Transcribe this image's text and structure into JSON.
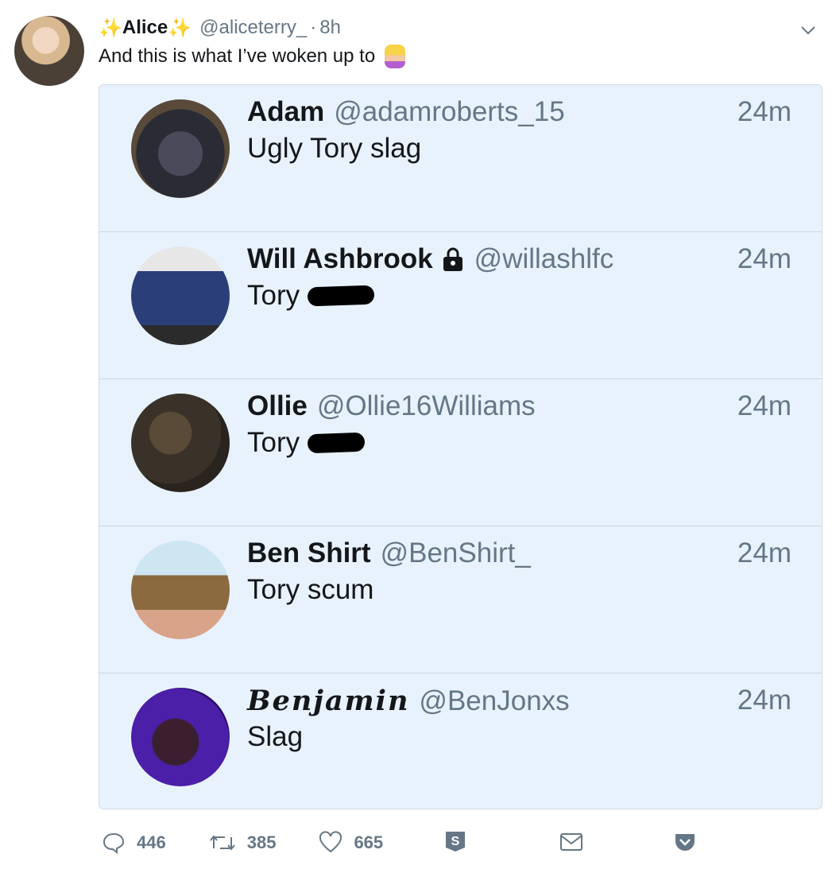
{
  "tweet": {
    "name": "Alice",
    "handle": "@aliceterry_",
    "separator": "·",
    "time": "8h",
    "text": "And this is what I’ve woken up to",
    "sparkle": "✨"
  },
  "replies": [
    {
      "name": "Adam",
      "handle": "@adamroberts_15",
      "time": "24m",
      "text": "Ugly Tory slag"
    },
    {
      "name": "Will Ashbrook",
      "handle": "@willashlfc",
      "time": "24m",
      "text": "Tory"
    },
    {
      "name": "Ollie",
      "handle": "@Ollie16Williams",
      "time": "24m",
      "text": "Tory"
    },
    {
      "name": "Ben Shirt",
      "handle": "@BenShirt_",
      "time": "24m",
      "text": "Tory scum"
    },
    {
      "name": "Benjamin",
      "handle": "@BenJonxs",
      "time": "24m",
      "text": "Slag"
    }
  ],
  "actions": {
    "replies": "446",
    "retweets": "385",
    "likes": "665"
  },
  "icons": [
    "chevron-down-icon",
    "reply-icon",
    "retweet-icon",
    "heart-icon",
    "s-extension-icon",
    "mail-icon",
    "pocket-icon",
    "lock-icon"
  ],
  "colors": {
    "accent_bg": "#e8f2fc",
    "muted": "#657786",
    "sparkle": "#f5b72b"
  }
}
